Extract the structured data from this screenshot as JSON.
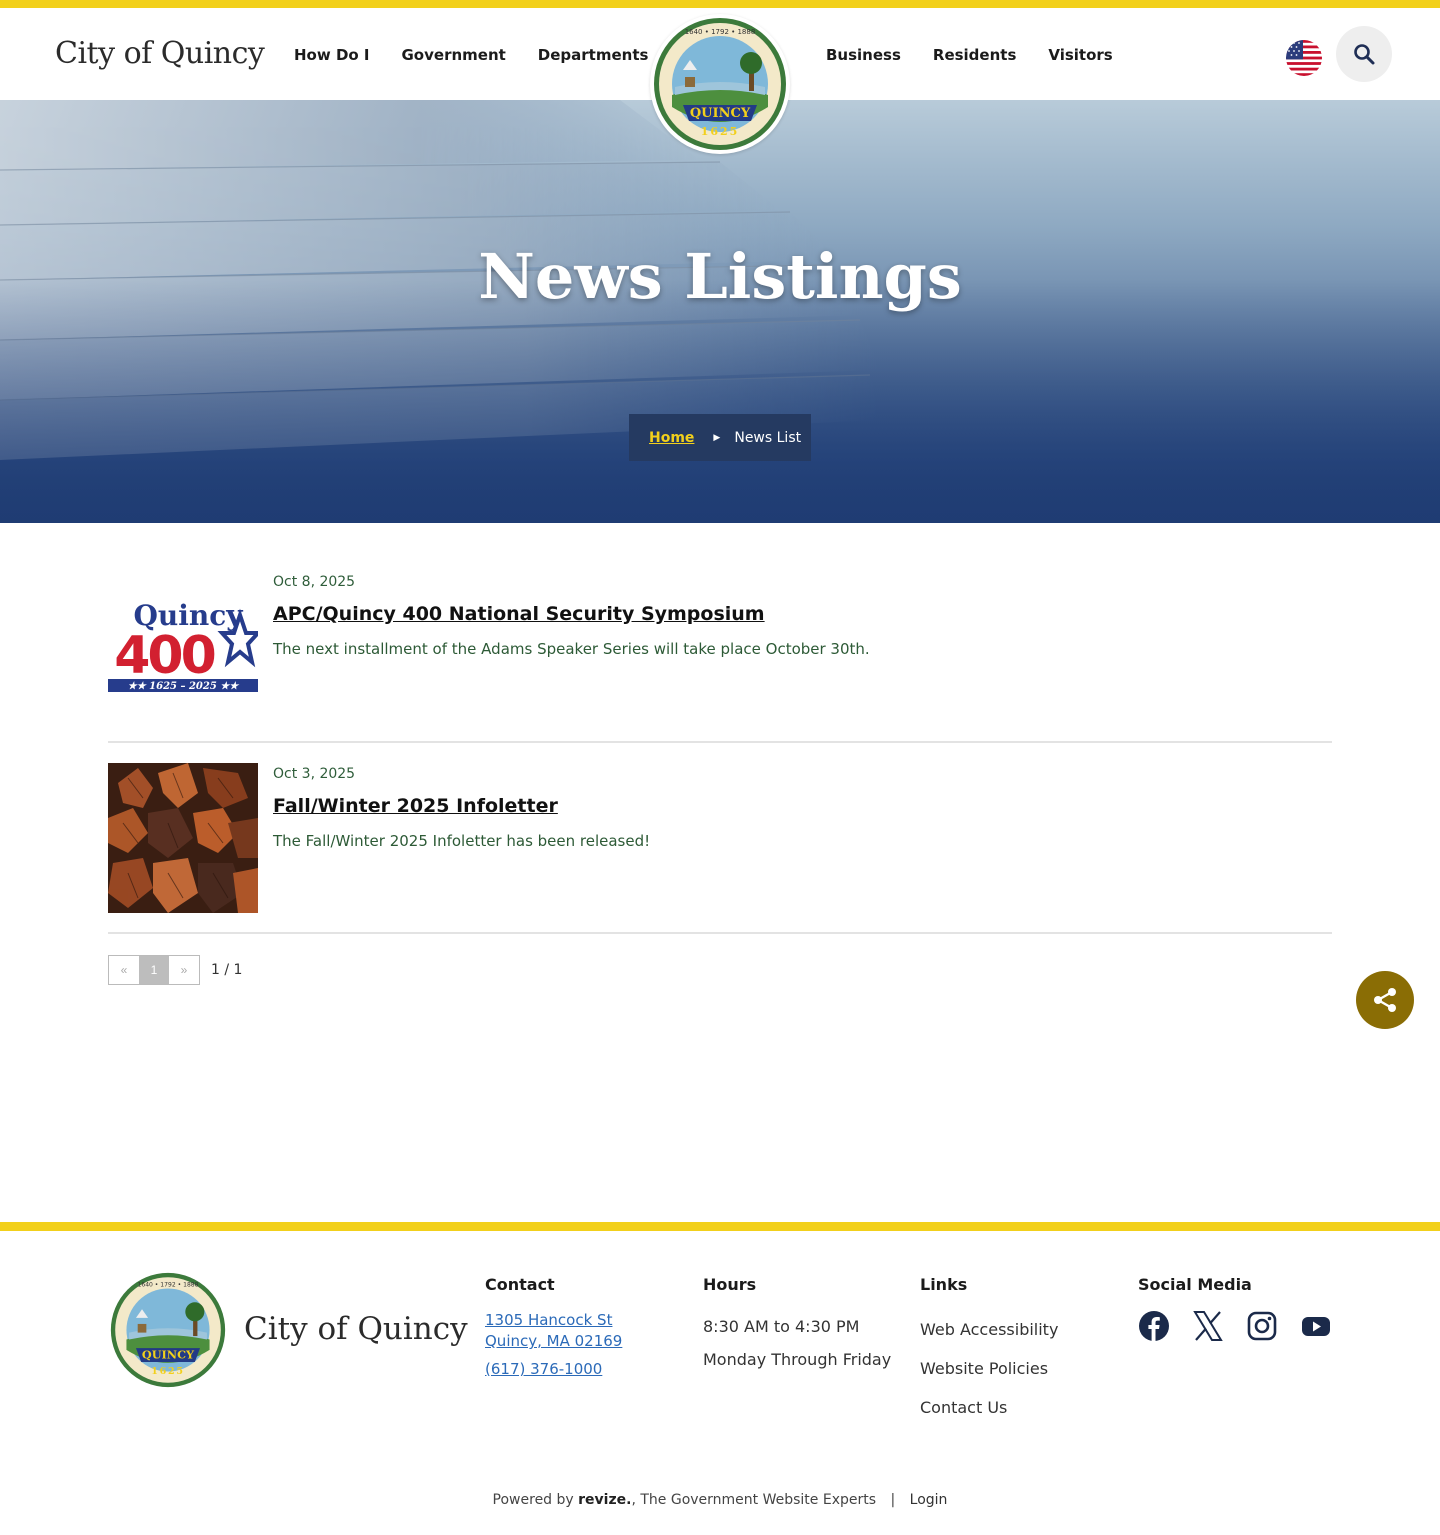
{
  "site": {
    "brand": "City of Quincy",
    "nav_left": [
      "How Do I",
      "Government",
      "Departments"
    ],
    "nav_right": [
      "Business",
      "Residents",
      "Visitors"
    ],
    "seal": {
      "text_top": "1640 • 1792 • 1888",
      "banner": "QUINCY",
      "year": "1625"
    }
  },
  "hero": {
    "title": "News Listings",
    "breadcrumb": {
      "home": "Home",
      "current": "News List"
    }
  },
  "news": [
    {
      "date": "Oct 8, 2025",
      "title": "APC/Quincy 400 National Security Symposium",
      "summary": "The next installment of the Adams Speaker Series will take place October 30th.",
      "thumb_text": {
        "word": "Quincy",
        "number": "400",
        "years": "★★ 1625 – 2025 ★★"
      }
    },
    {
      "date": "Oct 3, 2025",
      "title": "Fall/Winter 2025 Infoletter",
      "summary": "The Fall/Winter 2025 Infoletter has been released!"
    }
  ],
  "pager": {
    "prev": "«",
    "page": "1",
    "next": "»",
    "info": "1 / 1"
  },
  "footer": {
    "brand": "City of Quincy",
    "contact": {
      "heading": "Contact",
      "address1": "1305 Hancock St",
      "address2": "Quincy, MA 02169",
      "phone": "(617) 376-1000"
    },
    "hours": {
      "heading": "Hours",
      "line1": "8:30 AM to 4:30 PM",
      "line2": "Monday Through Friday"
    },
    "links": {
      "heading": "Links",
      "items": [
        "Web Accessibility",
        "Website Policies",
        "Contact Us"
      ]
    },
    "social": {
      "heading": "Social Media",
      "icons": [
        "facebook-icon",
        "x-icon",
        "instagram-icon",
        "youtube-icon"
      ]
    },
    "powered": {
      "prefix": "Powered by",
      "brand": "revize.",
      "suffix": ", The Government Website Experts",
      "login": "Login"
    }
  },
  "colors": {
    "accent_yellow": "#f2d01b",
    "breadcrumb_bg": "#253a61",
    "share_bg": "#8a6d05",
    "link_blue": "#2b6ab8"
  }
}
